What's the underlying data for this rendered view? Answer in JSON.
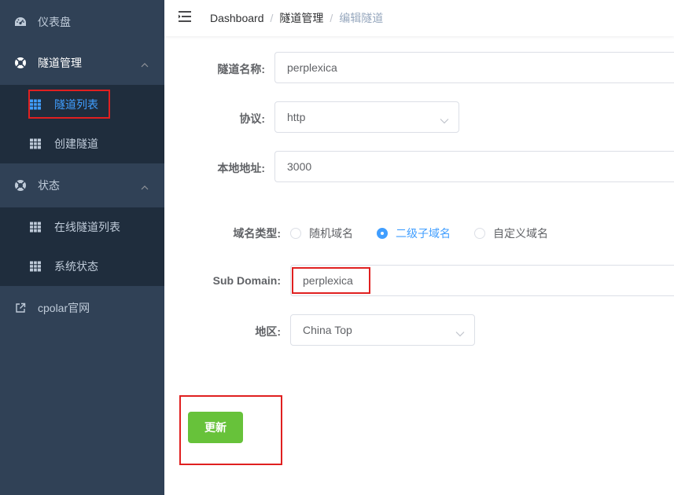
{
  "sidebar": {
    "dashboard": {
      "label": "仪表盘",
      "icon": "gauge-icon"
    },
    "tunnel_mgmt": {
      "label": "隧道管理",
      "icon": "lifebuoy-icon",
      "items": [
        {
          "label": "隧道列表",
          "icon": "table-grid-icon",
          "active": true
        },
        {
          "label": "创建隧道",
          "icon": "table-grid-icon",
          "active": false
        }
      ]
    },
    "status": {
      "label": "状态",
      "icon": "lifebuoy-icon",
      "items": [
        {
          "label": "在线隧道列表",
          "icon": "table-grid-icon"
        },
        {
          "label": "系统状态",
          "icon": "table-grid-icon"
        }
      ]
    },
    "website": {
      "label": "cpolar官网",
      "icon": "external-link-icon"
    }
  },
  "header": {
    "breadcrumb": [
      "Dashboard",
      "隧道管理",
      "编辑隧道"
    ],
    "separator": "/"
  },
  "form": {
    "name_label": "隧道名称:",
    "name_value": "perplexica",
    "protocol_label": "协议:",
    "protocol_value": "http",
    "local_addr_label": "本地地址:",
    "local_addr_value": "3000",
    "domain_type_label": "域名类型:",
    "domain_types": [
      "随机域名",
      "二级子域名",
      "自定义域名"
    ],
    "domain_type_selected": 1,
    "subdomain_label": "Sub Domain:",
    "subdomain_value": "perplexica",
    "region_label": "地区:",
    "region_value": "China Top",
    "update_button": "更新"
  },
  "colors": {
    "sidebar_bg": "#304156",
    "submenu_bg": "#1f2d3d",
    "accent": "#409eff",
    "success": "#67c23a",
    "highlight": "#e02020"
  }
}
